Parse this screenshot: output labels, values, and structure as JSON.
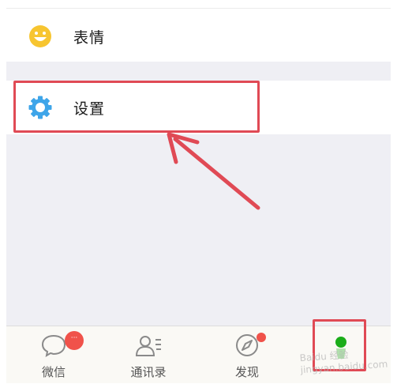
{
  "menu": {
    "items": [
      {
        "label": "表情",
        "icon": "smiley-icon",
        "color": "#f7c530"
      },
      {
        "label": "设置",
        "icon": "gear-icon",
        "color": "#3ea5e9"
      }
    ]
  },
  "tabbar": {
    "tabs": [
      {
        "label": "微信",
        "icon": "chat-bubble-icon",
        "badge": "···"
      },
      {
        "label": "通讯录",
        "icon": "contacts-icon"
      },
      {
        "label": "发现",
        "icon": "compass-icon"
      },
      {
        "label": "",
        "icon": "me-icon"
      }
    ],
    "active_color": "#1aad19"
  },
  "annotations": {
    "highlight_color": "#e04a55",
    "watermark": "Baidu 经验 jingyan.baidu.com"
  }
}
